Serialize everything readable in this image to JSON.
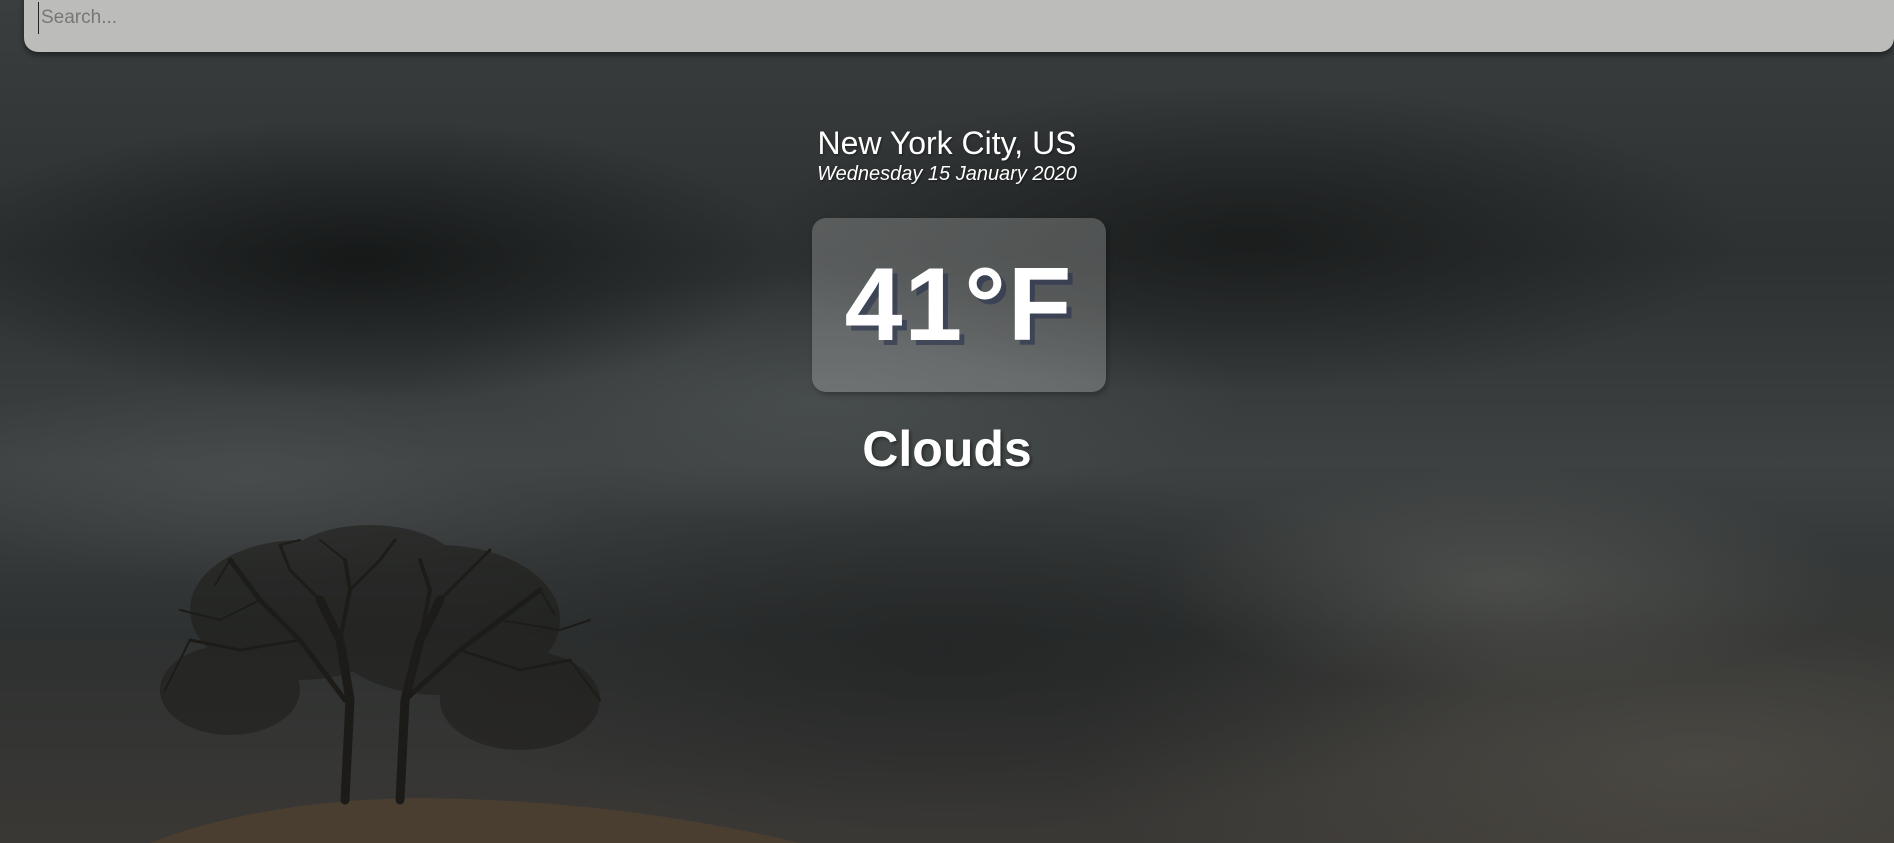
{
  "search": {
    "placeholder": "Search...",
    "value": ""
  },
  "weather": {
    "location": "New York City, US",
    "date": "Wednesday 15 January 2020",
    "temperature": "41°F",
    "condition": "Clouds"
  },
  "colors": {
    "text": "#ffffff",
    "search_bg": "#c8c8c6",
    "sky": "#2f3333"
  }
}
